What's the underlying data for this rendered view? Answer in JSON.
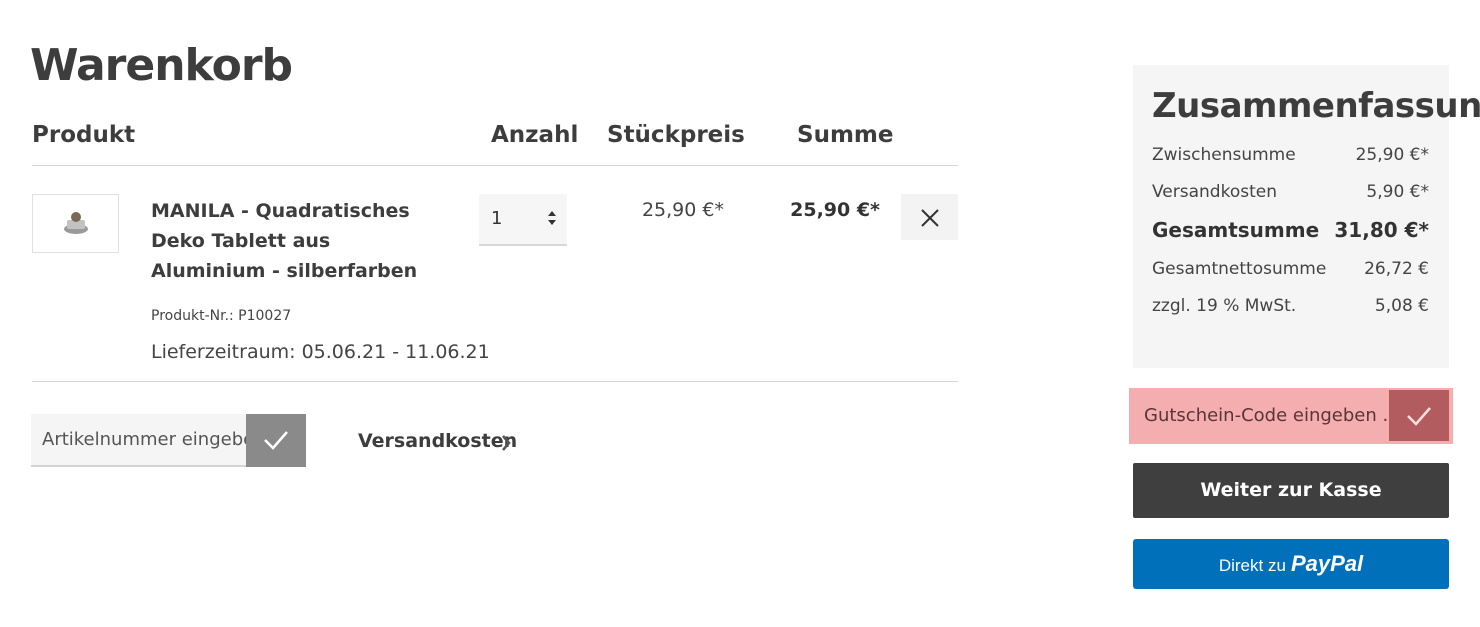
{
  "page": {
    "title": "Warenkorb"
  },
  "table": {
    "headers": {
      "product": "Produkt",
      "quantity": "Anzahl",
      "unit_price": "Stückpreis",
      "sum": "Summe"
    },
    "items": [
      {
        "name": "MANILA - Quadratisches Deko Tablett aus Aluminium - silberfarben",
        "product_number": "Produkt-Nr.: P10027",
        "delivery": "Lieferzeitraum: 05.06.21 - 11.06.21",
        "quantity": "1",
        "unit_price": "25,90 €*",
        "sum": "25,90 €*",
        "thumbnail_icon": "product-thumbnail",
        "remove_icon": "close-icon"
      }
    ]
  },
  "actions": {
    "article_number_placeholder": "Artikelnummer eingebe",
    "shipping_link": "Versandkosten"
  },
  "summary": {
    "title": "Zusammenfassung",
    "rows": [
      {
        "label": "Zwischensumme",
        "value": "25,90 €*"
      },
      {
        "label": "Versandkosten",
        "value": "5,90 €*"
      },
      {
        "label": "Gesamtsumme",
        "value": "31,80 €*",
        "emphasis": true
      },
      {
        "label": "Gesamtnettosumme",
        "value": "26,72 €"
      },
      {
        "label": "zzgl. 19 % MwSt.",
        "value": "5,08 €"
      }
    ],
    "coupon_placeholder": "Gutschein-Code eingeben ...",
    "checkout_label": "Weiter zur Kasse",
    "paypal_prefix": "Direkt zu",
    "paypal_logo": "PayPal"
  },
  "colors": {
    "coupon_highlight": "#f4aeb0",
    "coupon_button": "#b35c60",
    "checkout_button": "#3f3f3f",
    "paypal_button": "#0070ba"
  }
}
